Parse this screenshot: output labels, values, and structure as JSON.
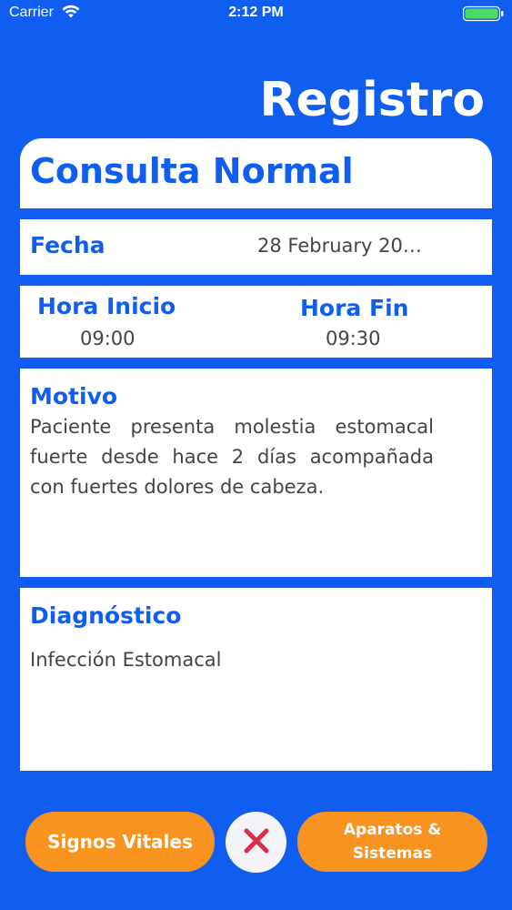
{
  "status_bar": {
    "carrier": "Carrier",
    "time": "2:12 PM"
  },
  "page_title": "Registro",
  "consulta": {
    "title": "Consulta Normal"
  },
  "fecha": {
    "label": "Fecha",
    "value": "28 February 20…"
  },
  "hora": {
    "inicio_label": "Hora Inicio",
    "inicio_value": "09:00",
    "fin_label": "Hora Fin",
    "fin_value": "09:30"
  },
  "motivo": {
    "label": "Motivo",
    "text": "Paciente presenta molestia estomacal fuerte desde hace 2 días acompañada con fuertes dolores de cabeza."
  },
  "diagnostico": {
    "label": "Diagnóstico",
    "text": "Infección Estomacal"
  },
  "buttons": {
    "signos_label": "Signos Vitales",
    "aparatos_label": "Aparatos & Sistemas"
  },
  "colors": {
    "background": "#0f5ef0",
    "accent_blue": "#0f5ef0",
    "button_orange": "#f7931e",
    "close_red": "#d9304a",
    "battery_green": "#4cd964"
  },
  "icons": {
    "wifi": "wifi-icon",
    "battery": "battery-icon",
    "close": "close-icon"
  }
}
